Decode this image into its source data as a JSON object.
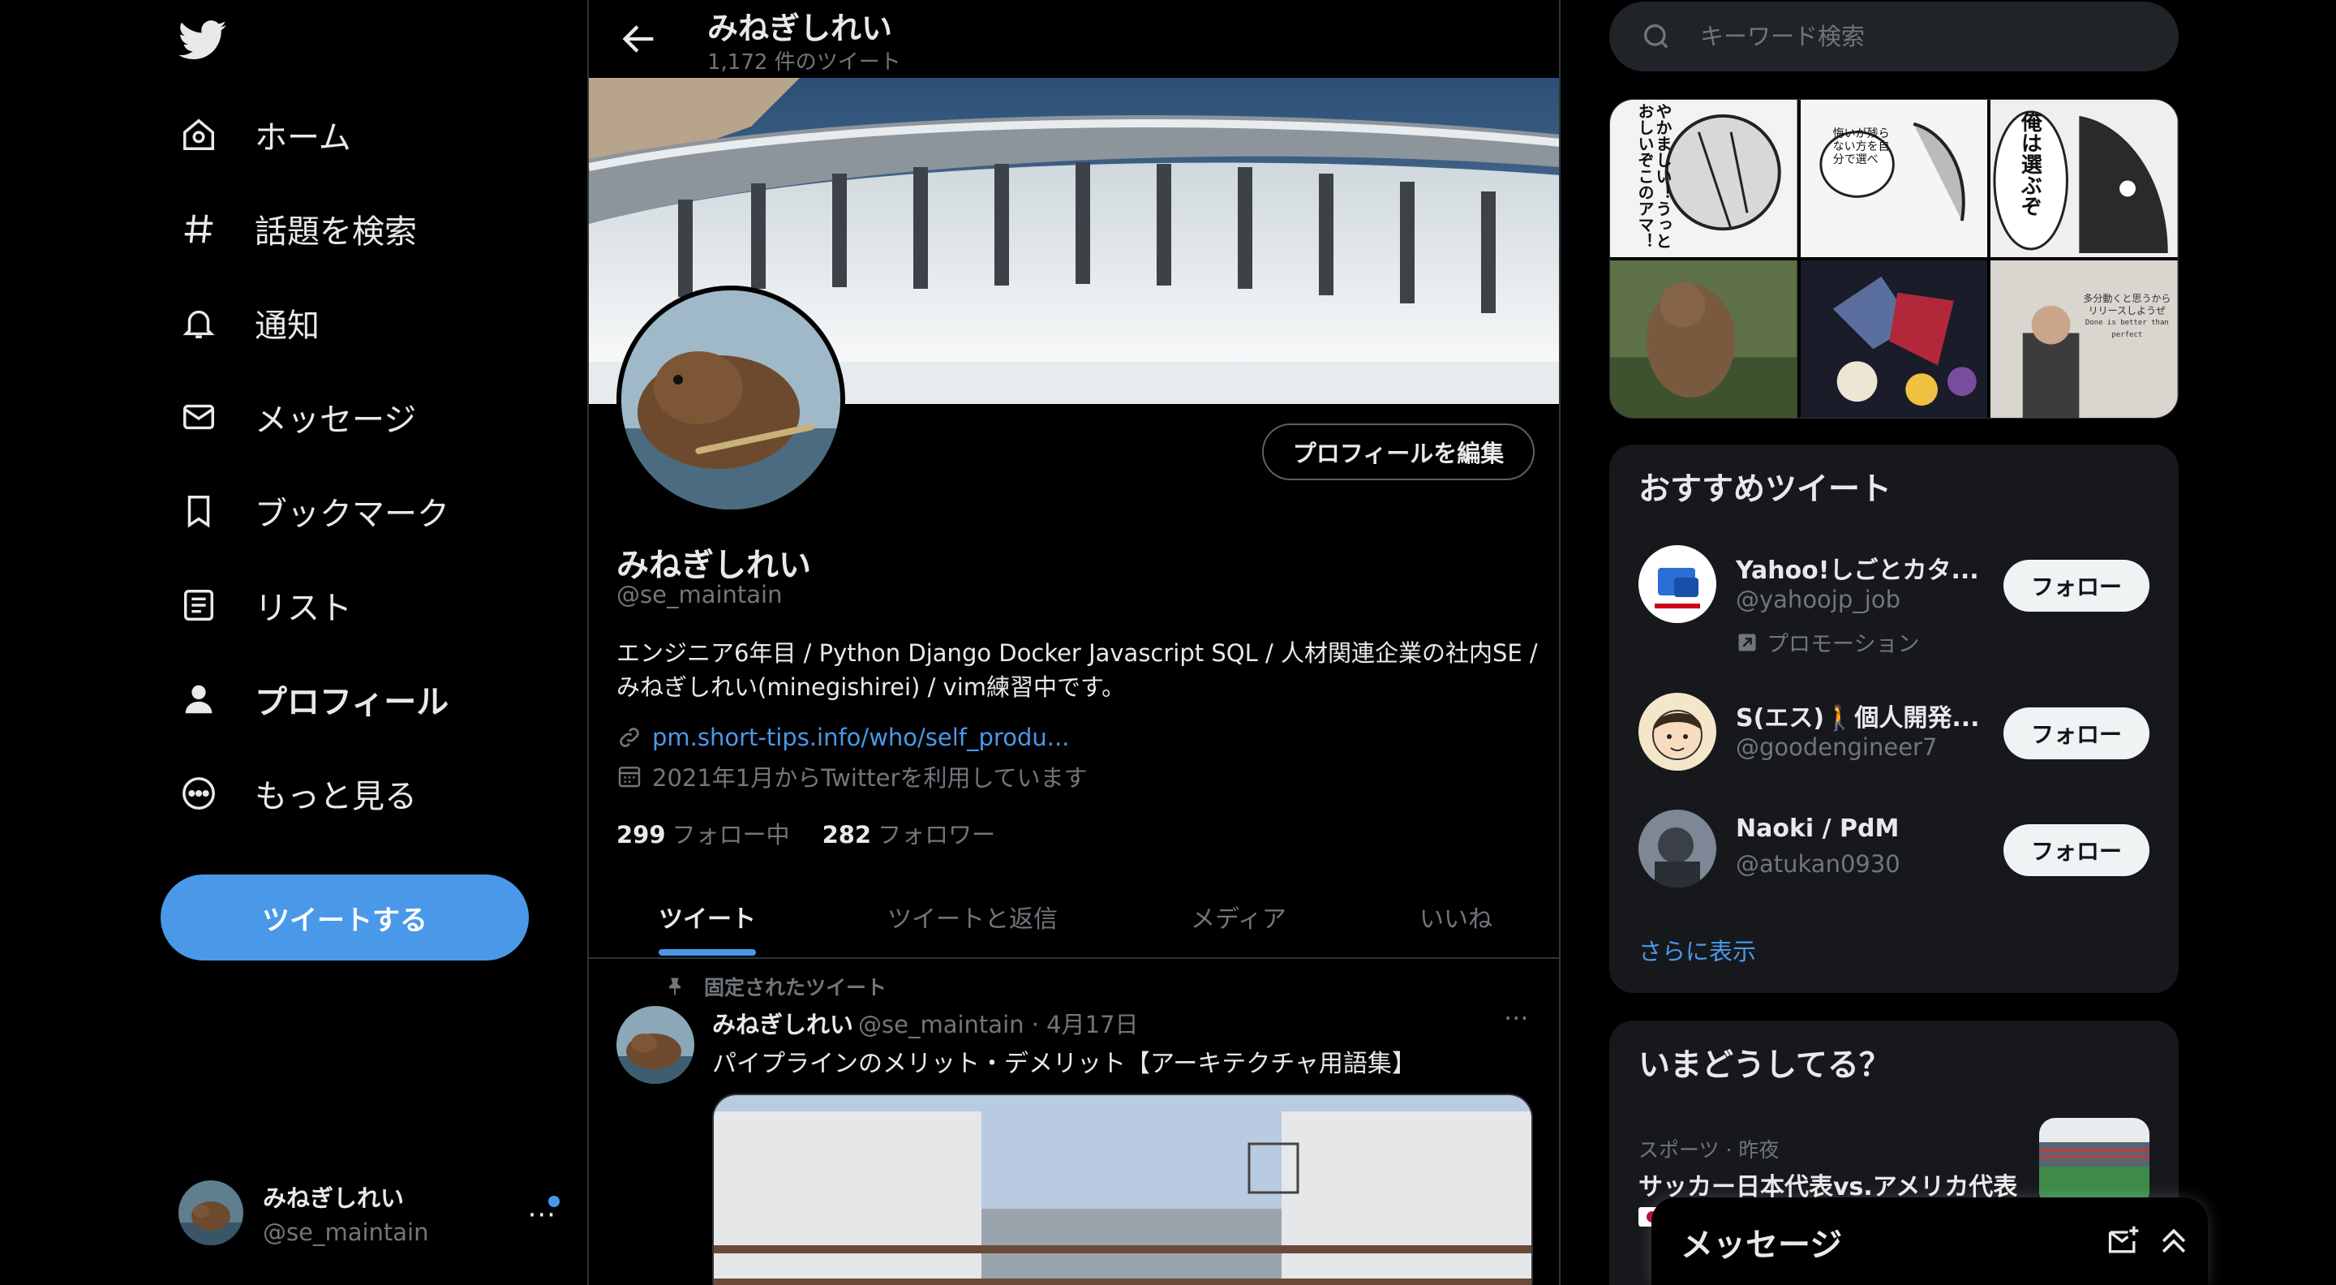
{
  "colors": {
    "accent": "#4a99e9",
    "background": "#000000",
    "card": "#16181c",
    "muted": "#71767b",
    "text": "#e7e9ea"
  },
  "nav": {
    "items": [
      {
        "label": "ホーム",
        "icon": "home-icon"
      },
      {
        "label": "話題を検索",
        "icon": "hashtag-icon"
      },
      {
        "label": "通知",
        "icon": "bell-icon"
      },
      {
        "label": "メッセージ",
        "icon": "mail-icon"
      },
      {
        "label": "ブックマーク",
        "icon": "bookmark-icon"
      },
      {
        "label": "リスト",
        "icon": "list-icon"
      },
      {
        "label": "プロフィール",
        "icon": "person-icon",
        "active": true
      },
      {
        "label": "もっと見る",
        "icon": "more-circle-icon"
      }
    ],
    "tweet_button": "ツイートする",
    "account": {
      "name": "みねぎしれい",
      "handle": "@se_maintain"
    }
  },
  "header": {
    "title": "みねぎしれい",
    "subtitle": "1,172 件のツイート"
  },
  "profile": {
    "edit_button": "プロフィールを編集",
    "name": "みねぎしれい",
    "handle": "@se_maintain",
    "bio_line1": "エンジニア6年目 / Python Django Docker Javascript SQL / 人材関連企業の社内SE /",
    "bio_line2": "みねぎしれい(minegishirei) / vim練習中です。",
    "link": "pm.short-tips.info/who/self_produ...",
    "joined": "2021年1月からTwitterを利用しています",
    "following_count": "299",
    "following_label": "フォロー中",
    "followers_count": "282",
    "followers_label": "フォロワー"
  },
  "tabs": [
    "ツイート",
    "ツイートと返信",
    "メディア",
    "いいね"
  ],
  "pinned_tweet": {
    "pinned_label": "固定されたツイート",
    "name": "みねぎしれい",
    "meta": "@se_maintain · 4月17日",
    "text": "パイプラインのメリット・デメリット【アーキテクチャ用語集】"
  },
  "search": {
    "placeholder": "キーワード検索"
  },
  "media_grid": {
    "cells": [
      "manga-panel-1",
      "manga-panel-2",
      "manga-panel-3",
      "beaver-photo",
      "pokemon-image",
      "speaker-photo"
    ],
    "texts": {
      "c1": "やかましい！うっとおしいぞこのアマ！",
      "c2": "悔いが残らない方を自分で選べ",
      "c3": "俺は選ぶぞ",
      "c6a": "多分動くと思うから",
      "c6b": "リリースしようぜ",
      "c6c": "Done is better than perfect"
    }
  },
  "who_to_follow": {
    "title": "おすすめツイート",
    "items": [
      {
        "name": "Yahoo!しごとカタ...",
        "handle": "@yahoojp_job",
        "promo": "プロモーション",
        "button": "フォロー"
      },
      {
        "name": "S(エス)🚶個人開発...",
        "handle": "@goodengineer7",
        "button": "フォロー"
      },
      {
        "name": "Naoki / PdM",
        "handle": "@atukan0930",
        "button": "フォロー"
      }
    ],
    "show_more": "さらに表示"
  },
  "trends": {
    "title": "いまどうしてる？",
    "meta": "スポーツ · 昨夜",
    "headline": "サッカー日本代表vs.アメリカ代表"
  },
  "messages_drawer": {
    "title": "メッセージ"
  }
}
